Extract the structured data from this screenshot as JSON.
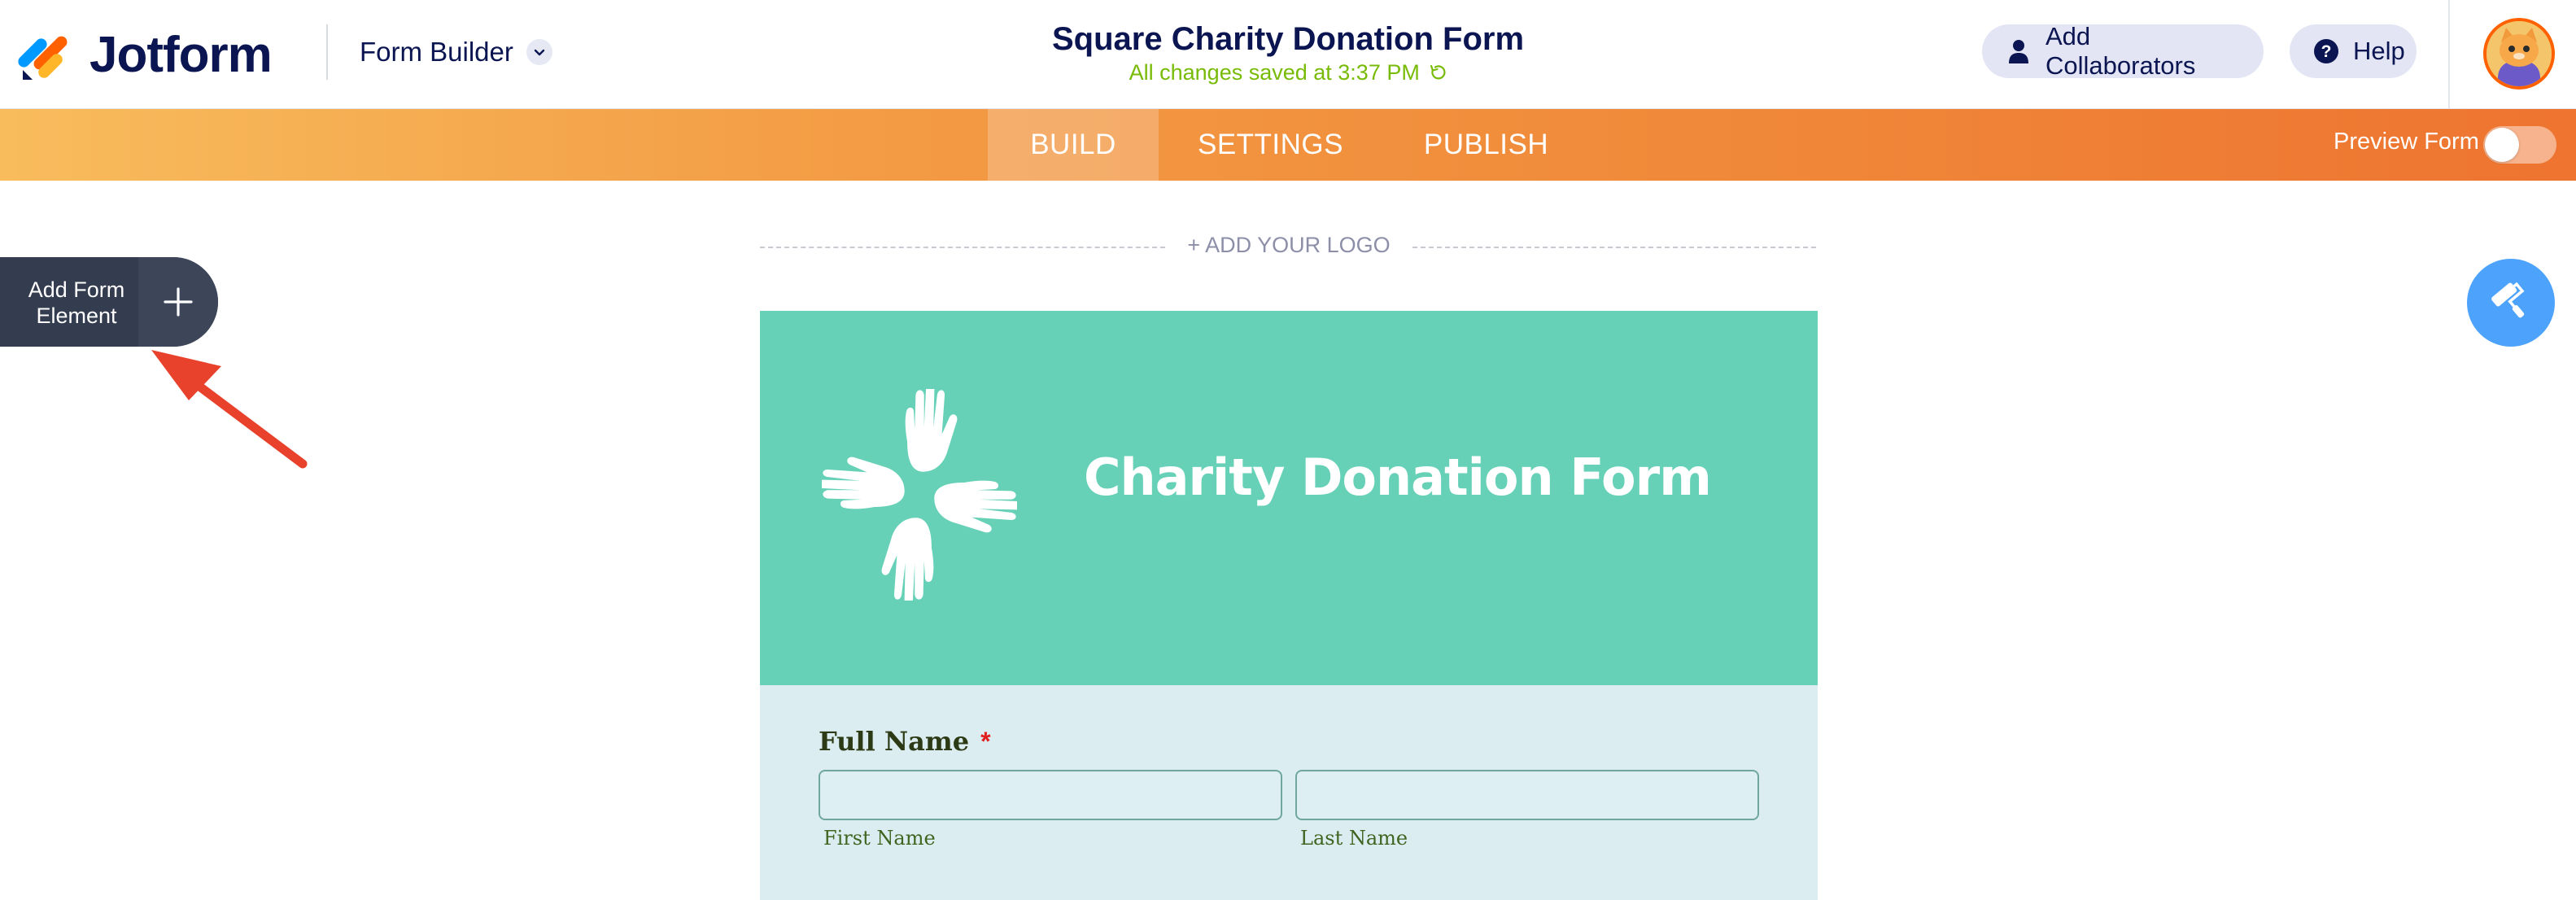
{
  "header": {
    "brand": "Jotform",
    "builder_menu": "Form Builder",
    "form_title": "Square Charity Donation Form",
    "saved_status": "All changes saved at 3:37 PM",
    "collaborators_button": "Add Collaborators",
    "help_button": "Help"
  },
  "nav": {
    "tabs": [
      "BUILD",
      "SETTINGS",
      "PUBLISH"
    ],
    "active_tab": "BUILD",
    "preview_label": "Preview Form",
    "preview_enabled": false
  },
  "sidebar": {
    "add_element_label": "Add Form Element"
  },
  "form": {
    "add_logo": "+ ADD YOUR LOGO",
    "heading": "Charity Donation Form",
    "fields": {
      "full_name": {
        "label": "Full Name",
        "required_mark": "*",
        "first_value": "",
        "last_value": "",
        "first_sublabel": "First Name",
        "last_sublabel": "Last Name"
      }
    }
  },
  "colors": {
    "nav_gradient_start": "#f8bc5d",
    "nav_gradient_end": "#ee7430",
    "form_header_bg": "#67d1b8",
    "form_body_bg": "#dcedf1",
    "saved_text": "#78bb07",
    "designer_button": "#4da3fb",
    "annotation_arrow": "#e8412c"
  }
}
